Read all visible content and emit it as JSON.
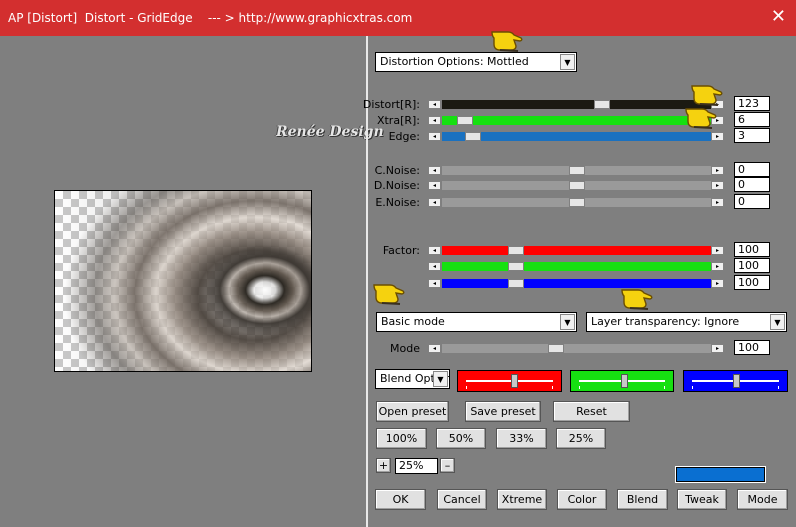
{
  "window": {
    "title": "AP [Distort]  Distort - GridEdge    --- > http://www.graphicxtras.com",
    "close_glyph": "✕"
  },
  "preview": {
    "logo_text": "Renée Design"
  },
  "options_dropdown": {
    "value": "Distortion Options: Mottled"
  },
  "sliders": [
    {
      "label": "Distort[R]:",
      "value": "123",
      "fill_color": "#1b1a12",
      "level": 0.6
    },
    {
      "label": "Xtra[R]:",
      "value": "6",
      "fill_color": "#16e011",
      "level": 0.06
    },
    {
      "label": "Edge:",
      "value": "3",
      "fill_color": "#1a71c0",
      "level": 0.09
    },
    {
      "label": "C.Noise:",
      "value": "0",
      "fill_color": "#9a9a9a",
      "level": 0.5
    },
    {
      "label": "D.Noise:",
      "value": "0",
      "fill_color": "#9a9a9a",
      "level": 0.5
    },
    {
      "label": "E.Noise:",
      "value": "0",
      "fill_color": "#9a9a9a",
      "level": 0.5
    },
    {
      "label": "Factor:",
      "value": "100",
      "fill_color": "#ff0000",
      "level": 0.26
    },
    {
      "label": "",
      "value": "100",
      "fill_color": "#16e011",
      "level": 0.26
    },
    {
      "label": "",
      "value": "100",
      "fill_color": "#0000ff",
      "level": 0.26
    },
    {
      "label": "Mode",
      "value": "100",
      "fill_color": "#9a9a9a",
      "level": 0.42
    }
  ],
  "mode_dropdown": {
    "value": "Basic mode"
  },
  "transparency_dropdown": {
    "value": "Layer transparency: Ignore"
  },
  "blend_dropdown": {
    "value": "Blend Options"
  },
  "color_sliders": [
    {
      "color": "#ff0000",
      "level": 0.55
    },
    {
      "color": "#16e011",
      "level": 0.52
    },
    {
      "color": "#0000ff",
      "level": 0.5
    }
  ],
  "buttons": {
    "open_preset": "Open preset",
    "save_preset": "Save preset",
    "reset": "Reset",
    "zoom100": "100%",
    "zoom50": "50%",
    "zoom33": "33%",
    "zoom25": "25%",
    "plus": "+",
    "minus": "–",
    "ok": "OK",
    "cancel": "Cancel",
    "xtreme": "Xtreme",
    "color": "Color",
    "blend": "Blend",
    "tweak": "Tweak",
    "mode": "Mode"
  },
  "zoom_value": "25%",
  "color_swatch": "#0a6fd1",
  "scroll_left_glyph": "◂",
  "scroll_right_glyph": "▸",
  "dropdown_arrow_glyph": "▼",
  "icons": [
    "hand-pointer-icon"
  ]
}
